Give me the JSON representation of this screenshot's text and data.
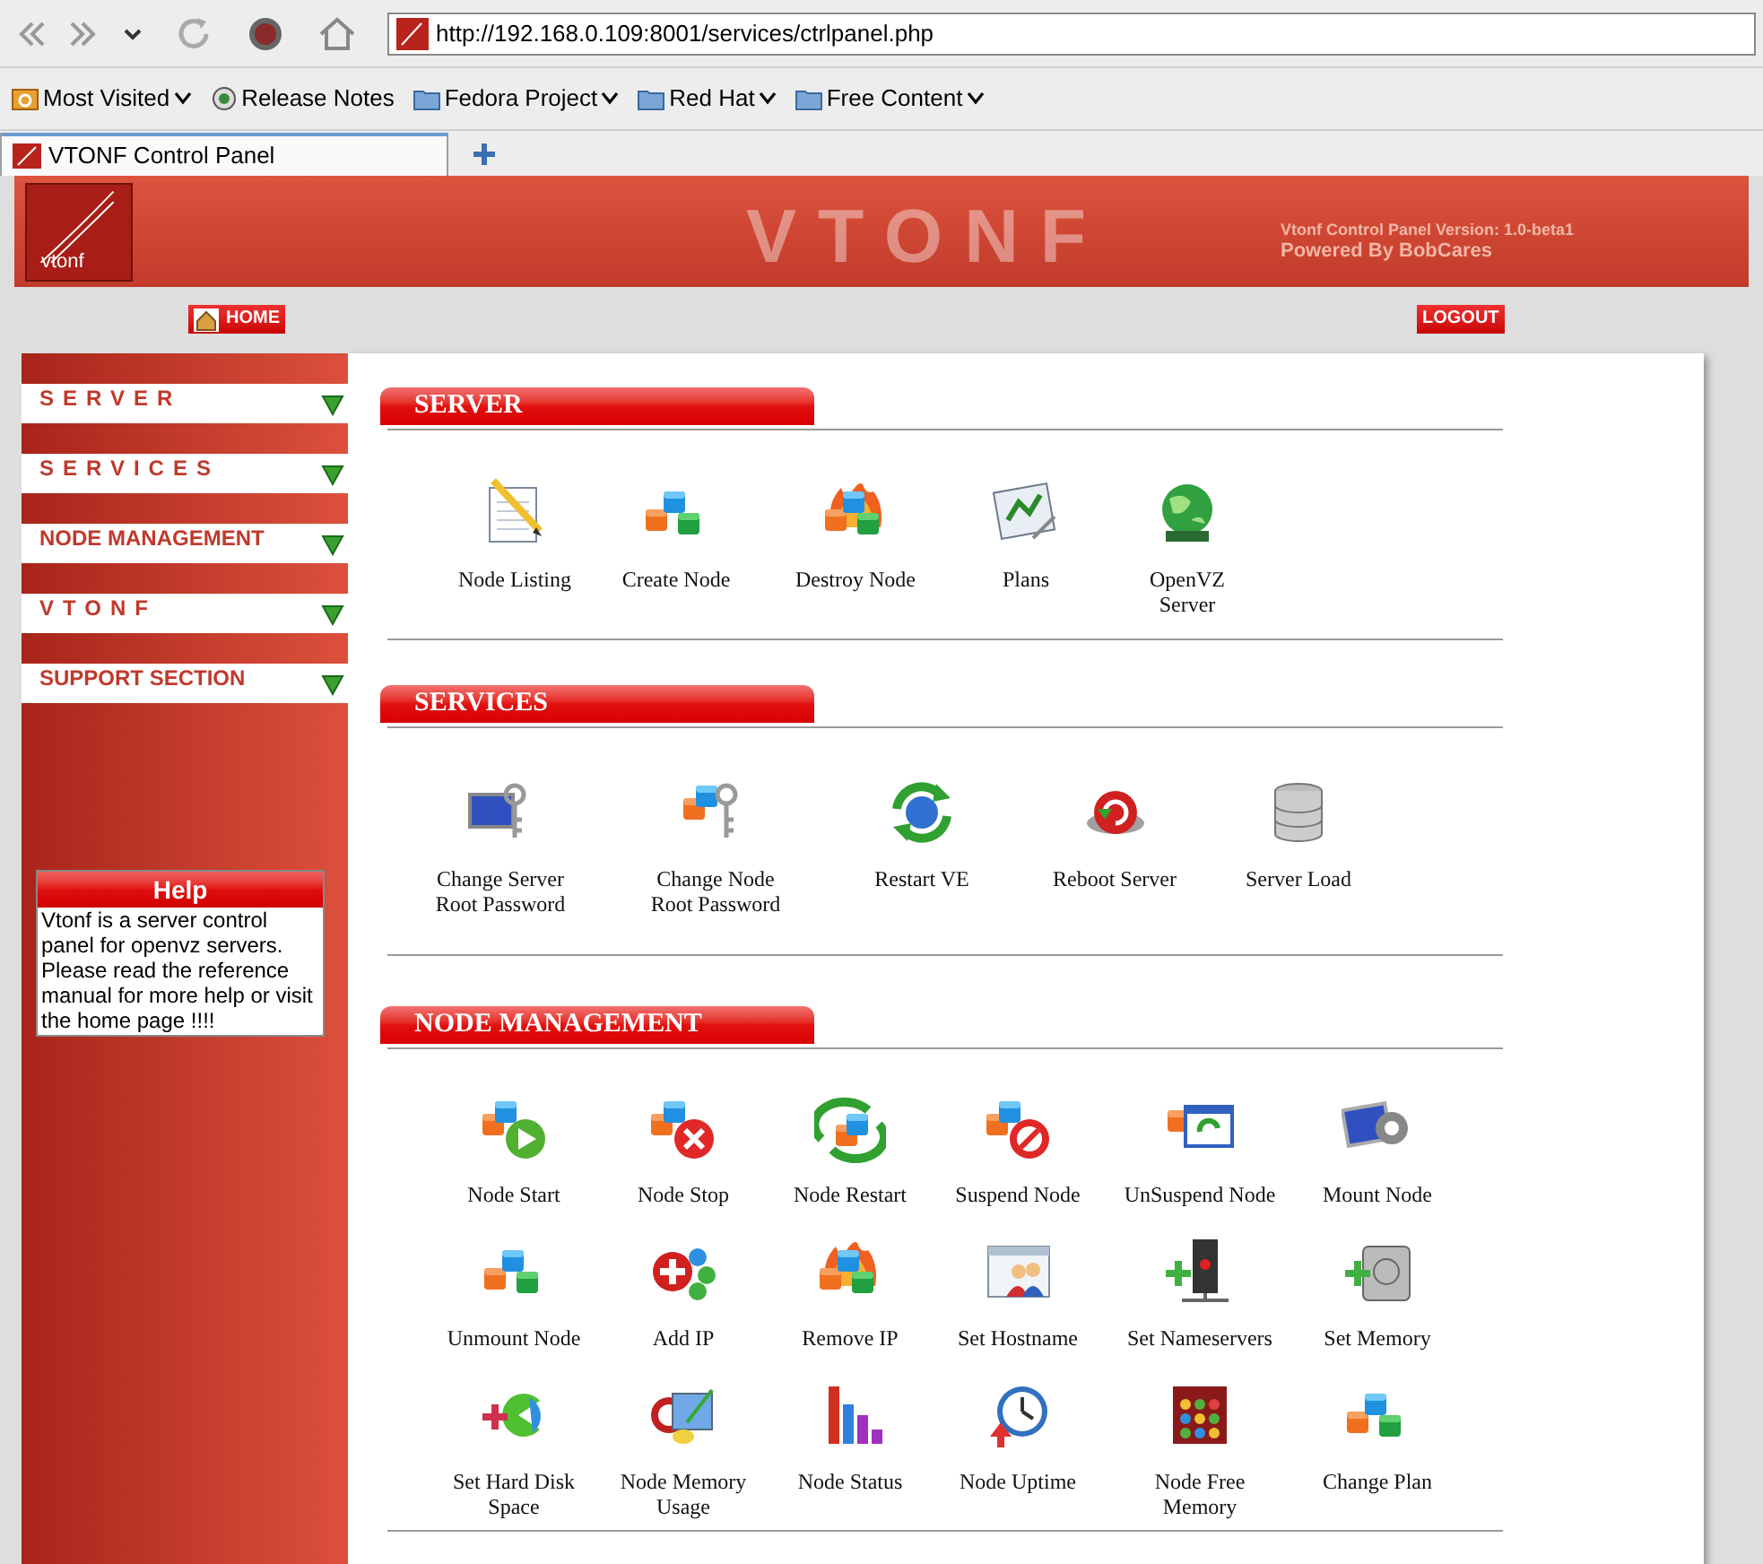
{
  "browser": {
    "url": "http://192.168.0.109:8001/services/ctrlpanel.php",
    "bookmarks": [
      {
        "label": "Most Visited",
        "kind": "recent",
        "menu": true
      },
      {
        "label": "Release Notes",
        "kind": "page",
        "menu": false
      },
      {
        "label": "Fedora Project",
        "kind": "folder",
        "menu": true
      },
      {
        "label": "Red Hat",
        "kind": "folder",
        "menu": true
      },
      {
        "label": "Free Content",
        "kind": "folder",
        "menu": true
      }
    ],
    "tabs": [
      {
        "label": "VTONF Control Panel",
        "selected": true
      }
    ]
  },
  "header": {
    "logo_text": "vtonf",
    "title": "VTONF",
    "version": "Vtonf Control Panel Version: 1.0-beta1",
    "powered_by": "Powered By BobCares"
  },
  "nav": {
    "home": "HOME",
    "logout": "LOGOUT"
  },
  "sidebar": {
    "items": [
      {
        "label": "SERVER",
        "spaced": true
      },
      {
        "label": "SERVICES",
        "spaced": true
      },
      {
        "label": "NODE MANAGEMENT",
        "spaced": false
      },
      {
        "label": "VTONF",
        "spaced": true
      },
      {
        "label": "SUPPORT SECTION",
        "spaced": false
      }
    ],
    "help": {
      "title": "Help",
      "text": "Vtonf is a server control panel for openvz servers. Please read the reference manual for more help or visit the home page !!!!"
    }
  },
  "sections": [
    {
      "title": "SERVER",
      "items": [
        "Node Listing",
        "Create Node",
        "Destroy Node",
        "Plans",
        "OpenVZ\nServer"
      ]
    },
    {
      "title": "SERVICES",
      "items": [
        "Change Server\nRoot Password",
        "Change Node\nRoot Password",
        "Restart VE",
        "Reboot Server",
        "Server Load"
      ]
    },
    {
      "title": "NODE MANAGEMENT",
      "items": [
        "Node Start",
        "Node Stop",
        "Node Restart",
        "Suspend Node",
        "UnSuspend Node",
        "Mount Node",
        "Unmount Node",
        "Add IP",
        "Remove IP",
        "Set Hostname",
        "Set Nameservers",
        "Set Memory",
        "Set Hard Disk\nSpace",
        "Node Memory\nUsage",
        "Node Status",
        "Node Uptime",
        "Node Free\nMemory",
        "Change Plan"
      ]
    }
  ]
}
